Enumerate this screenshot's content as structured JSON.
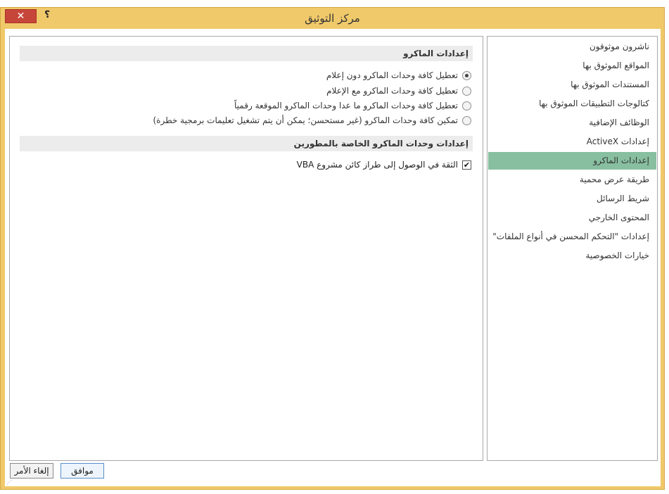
{
  "window": {
    "title": "مركز التوثيق",
    "close_glyph": "✕",
    "help_glyph": "؟"
  },
  "macro_settings": {
    "header": "إعدادات الماكرو",
    "options": [
      {
        "label": "تعطيل كافة وحدات الماكرو دون إعلام",
        "checked": true
      },
      {
        "label": "تعطيل كافة وحدات الماكرو مع الإعلام",
        "checked": false
      },
      {
        "label": "تعطيل كافة وحدات الماكرو ما عدا وحدات الماكرو الموقعة رقمياً",
        "checked": false
      },
      {
        "label": "تمكين كافة وحدات الماكرو (غير مستحسن؛ يمكن أن يتم تشغيل تعليمات برمجية خطرة)",
        "checked": false
      }
    ]
  },
  "developer_settings": {
    "header": "إعدادات وحدات الماكرو الخاصة بالمطورين",
    "vba_trust": {
      "label": "الثقة في الوصول إلى طراز كائن مشروع VBA",
      "checked": true,
      "check_glyph": "✔"
    }
  },
  "nav": {
    "items": [
      {
        "label": "ناشرون موثوقون"
      },
      {
        "label": "المواقع الموثوق بها"
      },
      {
        "label": "المستندات الموثوق بها"
      },
      {
        "label": "كتالوجات التطبيقات الموثوق بها"
      },
      {
        "label": "الوظائف الإضافية"
      },
      {
        "label": "إعدادات ActiveX"
      },
      {
        "label": "إعدادات الماكرو"
      },
      {
        "label": "طريقة عرض محمية"
      },
      {
        "label": "شريط الرسائل"
      },
      {
        "label": "المحتوى الخارجي"
      },
      {
        "label": "إعدادات \"التحكم المحسن في أنواع الملفات\""
      },
      {
        "label": "خيارات الخصوصية"
      }
    ],
    "selected_index": 6
  },
  "buttons": {
    "ok": "موافق",
    "cancel": "إلغاء الأمر"
  },
  "colors": {
    "titlebar": "#f0c96a",
    "selected_nav": "#87bfa0",
    "close_button": "#c7463a"
  }
}
